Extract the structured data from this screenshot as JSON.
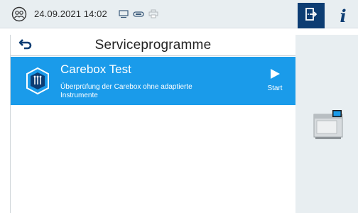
{
  "status": {
    "datetime": "24.09.2021 14:02",
    "icons": [
      "user-circle-icon",
      "monitor-icon",
      "link-icon",
      "printer-icon"
    ]
  },
  "header": {
    "info_label": "i",
    "icons": [
      "exit-door-icon",
      "info-icon"
    ]
  },
  "page": {
    "title": "Serviceprogramme",
    "back_icon": "back-arrow-icon"
  },
  "programs": [
    {
      "title": "Carebox Test",
      "description": "Überprüfung der Carebox ohne adaptierte Instrumente",
      "action_label": "Start",
      "icon": "carebox-shield-icon",
      "selected": true
    }
  ],
  "colors": {
    "accent": "#1a9bea",
    "dark_button": "#0d3d73",
    "panel": "#e8eef1"
  }
}
